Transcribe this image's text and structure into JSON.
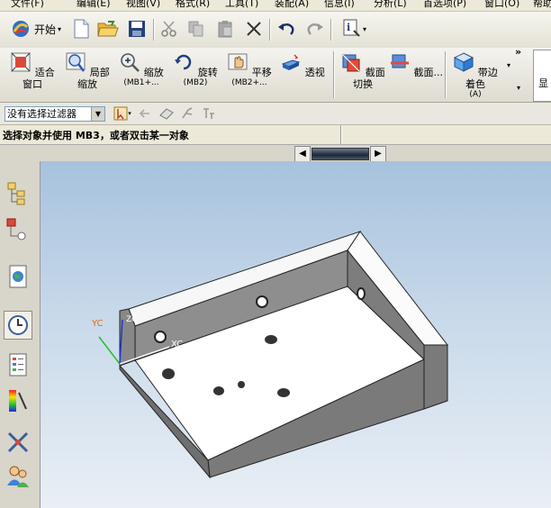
{
  "menu": [
    "文件(F)",
    "编辑(E)",
    "视图(V)",
    "格式(R)",
    "工具(T)",
    "装配(A)",
    "信息(I)",
    "分析(L)",
    "首选项(P)",
    "窗口(O)",
    "帮助"
  ],
  "toolbar": {
    "start_label": "开始"
  },
  "view_toolbar": [
    {
      "label": "适合窗口",
      "sub": ""
    },
    {
      "label": "局部缩放",
      "sub": ""
    },
    {
      "label": "缩放",
      "sub": "(MB1+..."
    },
    {
      "label": "旋转",
      "sub": "(MB2)"
    },
    {
      "label": "平移",
      "sub": "(MB2+..."
    },
    {
      "label": "透视",
      "sub": ""
    },
    {
      "label": "截面切换",
      "sub": ""
    },
    {
      "label": "截面...",
      "sub": ""
    },
    {
      "label": "带边着色",
      "sub": "(A)"
    },
    {
      "label": "显",
      "sub": ""
    }
  ],
  "filter": {
    "value": "没有选择过滤器"
  },
  "cue": {
    "text": "选择对象并使用 MB3，或者双击某一对象"
  },
  "triad": {
    "yc": "YC",
    "zc": "ZC",
    "xc": "XC"
  },
  "colors": {
    "part_face": "#ffffff",
    "part_side": "#8c8c8c",
    "part_side_dark": "#6f6f6f",
    "bg_top": "#a7c2dd",
    "bg_bottom": "#e9eff5"
  }
}
